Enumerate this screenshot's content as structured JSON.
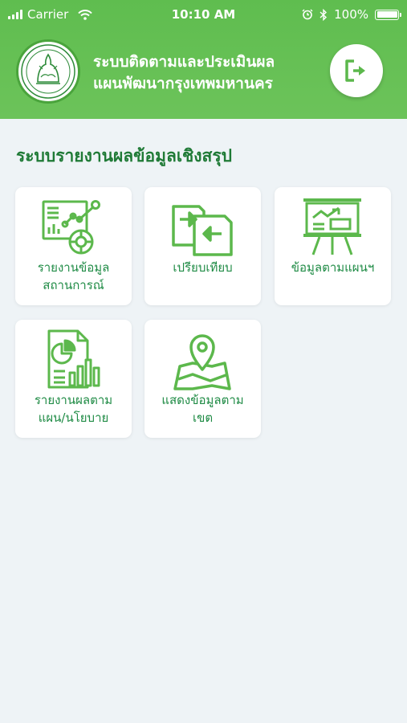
{
  "status_bar": {
    "carrier": "Carrier",
    "time": "10:10 AM",
    "battery": "100%",
    "icons": [
      "signal-icon",
      "wifi-icon",
      "alarm-icon",
      "bluetooth-icon",
      "battery-icon"
    ]
  },
  "header": {
    "title_line1": "ระบบติดตามและประเมินผล",
    "title_line2": "แผนพัฒนากรุงเทพมหานคร",
    "logo_icon": "bangkok-seal-logo",
    "logout_icon": "logout-icon"
  },
  "section_title": "ระบบรายงานผลข้อมูลเชิงสรุป",
  "menu": [
    {
      "line1": "รายงานข้อมูล",
      "line2": "สถานการณ์",
      "icon": "report-analytics-icon"
    },
    {
      "line1": "เปรียบเทียบ",
      "line2": "",
      "icon": "compare-icon"
    },
    {
      "line1": "ข้อมูลตามแผนฯ",
      "line2": "",
      "icon": "presentation-board-icon"
    },
    {
      "line1": "รายงานผลตาม",
      "line2": "แผน/นโยบาย",
      "icon": "document-chart-icon"
    },
    {
      "line1": "แสดงข้อมูลตาม",
      "line2": "เขต",
      "icon": "map-pin-icon"
    }
  ],
  "colors": {
    "header_green": "#66c056",
    "accent_green": "#1f8b45",
    "icon_green": "#5cb84c",
    "background": "#eef3f6"
  }
}
